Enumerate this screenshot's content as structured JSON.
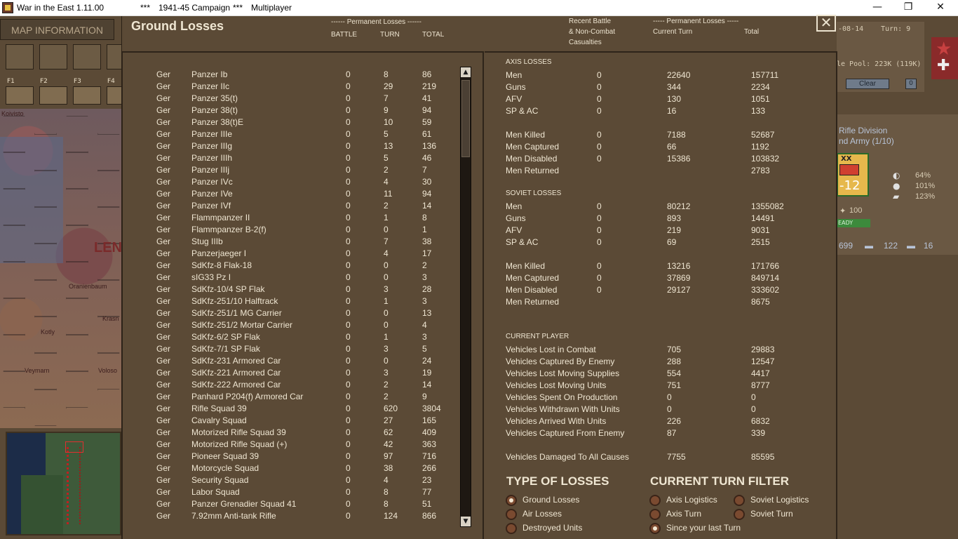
{
  "window": {
    "app_title": "War in the East 1.11.00",
    "stars_left": "***",
    "campaign": "1941-45 Campaign",
    "stars_right": "***",
    "mode": "Multiplayer",
    "minimize": "—",
    "restore": "❐",
    "close": "✕"
  },
  "background": {
    "map_information": "MAP INFORMATION",
    "fkeys": [
      "F1",
      "F2",
      "F3",
      "F4"
    ],
    "map_labels": [
      "Koivisto",
      "LEN",
      "Oranienbaum",
      "Krasn",
      "Kotly",
      "Veymarn",
      "Voloso"
    ],
    "date_fragment": "-08-14",
    "turn_fragment": "Turn: 9",
    "pool_fragment": "le Pool: 223K (119K)",
    "clear_label": "Clear",
    "small_box": "0",
    "unit_line1": "Rifle Division",
    "unit_line2": "nd Army (1/10)",
    "counter_xx": "XX",
    "counter_num": "-12",
    "stat_values": [
      "64%",
      "101%",
      "123%"
    ],
    "counter_strength": "100",
    "ready_label": "EADY",
    "bottom_stats": [
      "699",
      "122",
      "16"
    ]
  },
  "modal": {
    "title": "Ground Losses",
    "close_icon": "✕",
    "left_headers": {
      "group": "------ Permanent Losses ------",
      "battle": "BATTLE",
      "turn": "TURN",
      "total": "TOTAL"
    },
    "right_headers": {
      "recent_line1": "Recent Battle",
      "recent_line2": "& Non-Combat",
      "recent_line3": "Casualties",
      "group": "----- Permanent Losses -----",
      "current_turn": "Current Turn",
      "total": "Total"
    },
    "losses_table": [
      {
        "nation": "Ger",
        "name": "Panzer Ib",
        "battle": "0",
        "turn": "8",
        "total": "86"
      },
      {
        "nation": "Ger",
        "name": "Panzer IIc",
        "battle": "0",
        "turn": "29",
        "total": "219"
      },
      {
        "nation": "Ger",
        "name": "Panzer 35(t)",
        "battle": "0",
        "turn": "7",
        "total": "41"
      },
      {
        "nation": "Ger",
        "name": "Panzer 38(t)",
        "battle": "0",
        "turn": "9",
        "total": "94"
      },
      {
        "nation": "Ger",
        "name": "Panzer 38(t)E",
        "battle": "0",
        "turn": "10",
        "total": "59"
      },
      {
        "nation": "Ger",
        "name": "Panzer IIIe",
        "battle": "0",
        "turn": "5",
        "total": "61"
      },
      {
        "nation": "Ger",
        "name": "Panzer IIIg",
        "battle": "0",
        "turn": "13",
        "total": "136"
      },
      {
        "nation": "Ger",
        "name": "Panzer IIIh",
        "battle": "0",
        "turn": "5",
        "total": "46"
      },
      {
        "nation": "Ger",
        "name": "Panzer IIIj",
        "battle": "0",
        "turn": "2",
        "total": "7"
      },
      {
        "nation": "Ger",
        "name": "Panzer IVc",
        "battle": "0",
        "turn": "4",
        "total": "30"
      },
      {
        "nation": "Ger",
        "name": "Panzer IVe",
        "battle": "0",
        "turn": "11",
        "total": "94"
      },
      {
        "nation": "Ger",
        "name": "Panzer IVf",
        "battle": "0",
        "turn": "2",
        "total": "14"
      },
      {
        "nation": "Ger",
        "name": "Flammpanzer II",
        "battle": "0",
        "turn": "1",
        "total": "8"
      },
      {
        "nation": "Ger",
        "name": "Flammpanzer B-2(f)",
        "battle": "0",
        "turn": "0",
        "total": "1"
      },
      {
        "nation": "Ger",
        "name": "Stug IIIb",
        "battle": "0",
        "turn": "7",
        "total": "38"
      },
      {
        "nation": "Ger",
        "name": "Panzerjaeger I",
        "battle": "0",
        "turn": "4",
        "total": "17"
      },
      {
        "nation": "Ger",
        "name": "SdKfz-8 Flak-18",
        "battle": "0",
        "turn": "0",
        "total": "2"
      },
      {
        "nation": "Ger",
        "name": "sIG33 Pz I",
        "battle": "0",
        "turn": "0",
        "total": "3"
      },
      {
        "nation": "Ger",
        "name": "SdKfz-10/4 SP Flak",
        "battle": "0",
        "turn": "3",
        "total": "28"
      },
      {
        "nation": "Ger",
        "name": "SdKfz-251/10 Halftrack",
        "battle": "0",
        "turn": "1",
        "total": "3"
      },
      {
        "nation": "Ger",
        "name": "SdKfz-251/1 MG Carrier",
        "battle": "0",
        "turn": "0",
        "total": "13"
      },
      {
        "nation": "Ger",
        "name": "SdKfz-251/2 Mortar Carrier",
        "battle": "0",
        "turn": "0",
        "total": "4"
      },
      {
        "nation": "Ger",
        "name": "SdKfz-6/2 SP Flak",
        "battle": "0",
        "turn": "1",
        "total": "3"
      },
      {
        "nation": "Ger",
        "name": "SdKfz-7/1 SP Flak",
        "battle": "0",
        "turn": "3",
        "total": "5"
      },
      {
        "nation": "Ger",
        "name": "SdKfz-231 Armored Car",
        "battle": "0",
        "turn": "0",
        "total": "24"
      },
      {
        "nation": "Ger",
        "name": "SdKfz-221 Armored Car",
        "battle": "0",
        "turn": "3",
        "total": "19"
      },
      {
        "nation": "Ger",
        "name": "SdKfz-222 Armored Car",
        "battle": "0",
        "turn": "2",
        "total": "14"
      },
      {
        "nation": "Ger",
        "name": "Panhard P204(f) Armored Car",
        "battle": "0",
        "turn": "2",
        "total": "9"
      },
      {
        "nation": "Ger",
        "name": "Rifle Squad 39",
        "battle": "0",
        "turn": "620",
        "total": "3804"
      },
      {
        "nation": "Ger",
        "name": "Cavalry Squad",
        "battle": "0",
        "turn": "27",
        "total": "165"
      },
      {
        "nation": "Ger",
        "name": "Motorized Rifle Squad 39",
        "battle": "0",
        "turn": "62",
        "total": "409"
      },
      {
        "nation": "Ger",
        "name": "Motorized Rifle Squad (+)",
        "battle": "0",
        "turn": "42",
        "total": "363"
      },
      {
        "nation": "Ger",
        "name": "Pioneer Squad 39",
        "battle": "0",
        "turn": "97",
        "total": "716"
      },
      {
        "nation": "Ger",
        "name": "Motorcycle Squad",
        "battle": "0",
        "turn": "38",
        "total": "266"
      },
      {
        "nation": "Ger",
        "name": "Security Squad",
        "battle": "0",
        "turn": "4",
        "total": "23"
      },
      {
        "nation": "Ger",
        "name": "Labor Squad",
        "battle": "0",
        "turn": "8",
        "total": "77"
      },
      {
        "nation": "Ger",
        "name": "Panzer Grenadier Squad 41",
        "battle": "0",
        "turn": "8",
        "total": "51"
      },
      {
        "nation": "Ger",
        "name": "7.92mm Anti-tank Rifle",
        "battle": "0",
        "turn": "124",
        "total": "866"
      }
    ],
    "scroll_up": "▲",
    "scroll_down": "▼",
    "axis_title": "AXIS LOSSES",
    "axis_stats": [
      {
        "label": "Men",
        "recent": "0",
        "turn": "22640",
        "total": "157711"
      },
      {
        "label": "Guns",
        "recent": "0",
        "turn": "344",
        "total": "2234"
      },
      {
        "label": "AFV",
        "recent": "0",
        "turn": "130",
        "total": "1051"
      },
      {
        "label": "SP & AC",
        "recent": "0",
        "turn": "16",
        "total": "133"
      },
      {
        "label": "Men Killed",
        "recent": "0",
        "turn": "7188",
        "total": "52687"
      },
      {
        "label": "Men Captured",
        "recent": "0",
        "turn": "66",
        "total": "1192"
      },
      {
        "label": "Men Disabled",
        "recent": "0",
        "turn": "15386",
        "total": "103832"
      },
      {
        "label": "Men Returned",
        "recent": "",
        "turn": "",
        "total": "2783"
      }
    ],
    "soviet_title": "SOVIET LOSSES",
    "soviet_stats": [
      {
        "label": "Men",
        "recent": "0",
        "turn": "80212",
        "total": "1355082"
      },
      {
        "label": "Guns",
        "recent": "0",
        "turn": "893",
        "total": "14491"
      },
      {
        "label": "AFV",
        "recent": "0",
        "turn": "219",
        "total": "9031"
      },
      {
        "label": "SP & AC",
        "recent": "0",
        "turn": "69",
        "total": "2515"
      },
      {
        "label": "Men Killed",
        "recent": "0",
        "turn": "13216",
        "total": "171766"
      },
      {
        "label": "Men Captured",
        "recent": "0",
        "turn": "37869",
        "total": "849714"
      },
      {
        "label": "Men Disabled",
        "recent": "0",
        "turn": "29127",
        "total": "333602"
      },
      {
        "label": "Men Returned",
        "recent": "",
        "turn": "",
        "total": "8675"
      }
    ],
    "player_title": "CURRENT PLAYER",
    "player_stats": [
      {
        "label": "Vehicles Lost in Combat",
        "turn": "705",
        "total": "29883"
      },
      {
        "label": "Vehicles Captured By Enemy",
        "turn": "288",
        "total": "12547"
      },
      {
        "label": "Vehicles Lost Moving Supplies",
        "turn": "554",
        "total": "4417"
      },
      {
        "label": "Vehicles Lost Moving Units",
        "turn": "751",
        "total": "8777"
      },
      {
        "label": "Vehicles Spent On Production",
        "turn": "0",
        "total": "0"
      },
      {
        "label": "Vehicles Withdrawn With Units",
        "turn": "0",
        "total": "0"
      },
      {
        "label": "Vehicles Arrived With Units",
        "turn": "226",
        "total": "6832"
      },
      {
        "label": "Vehicles Captured From Enemy",
        "turn": "87",
        "total": "339"
      },
      {
        "label": "Vehicles Damaged To All Causes",
        "turn": "7755",
        "total": "85595"
      }
    ],
    "type_of_losses": {
      "title": "TYPE OF LOSSES",
      "options": [
        {
          "label": "Ground Losses",
          "selected": true
        },
        {
          "label": "Air Losses",
          "selected": false
        },
        {
          "label": "Destroyed Units",
          "selected": false
        }
      ]
    },
    "turn_filter": {
      "title": "CURRENT TURN FILTER",
      "options": [
        {
          "label": "Axis Logistics",
          "selected": false
        },
        {
          "label": "Soviet Logistics",
          "selected": false
        },
        {
          "label": "Axis Turn",
          "selected": false
        },
        {
          "label": "Soviet Turn",
          "selected": false
        },
        {
          "label": "Since your last Turn",
          "selected": true
        }
      ]
    }
  }
}
